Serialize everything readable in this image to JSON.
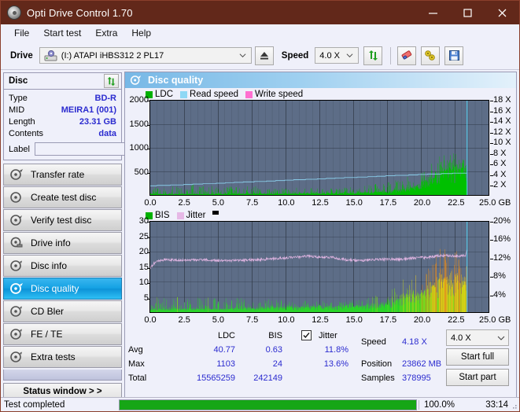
{
  "window": {
    "title": "Opti Drive Control 1.70",
    "icon": "disc-icon",
    "minimize": "minimize-icon",
    "maximize": "maximize-icon",
    "close": "close-icon"
  },
  "menu": {
    "items": [
      "File",
      "Start test",
      "Extra",
      "Help"
    ]
  },
  "toolbar": {
    "drive_label": "Drive",
    "drive_value": "(I:)  ATAPI iHBS312  2 PL17",
    "eject_icon": "eject-icon",
    "speed_label": "Speed",
    "speed_value": "4.0 X",
    "refresh_icon": "refresh-icon",
    "erase_icon": "eraser-icon",
    "tools_icon": "wrench-icon",
    "save_icon": "floppy-save-icon"
  },
  "disc": {
    "title": "Disc",
    "refresh_icon": "refresh-icon",
    "rows": [
      {
        "key": "Type",
        "value": "BD-R"
      },
      {
        "key": "MID",
        "value": "MEIRA1 (001)"
      },
      {
        "key": "Length",
        "value": "23.31 GB"
      },
      {
        "key": "Contents",
        "value": "data"
      }
    ],
    "label_key": "Label",
    "label_value": "",
    "label_placeholder": "",
    "label_btn_icon": "disc-icon"
  },
  "nav": {
    "items": [
      {
        "label": "Transfer rate",
        "icon": "disc-speed-icon",
        "selected": false
      },
      {
        "label": "Create test disc",
        "icon": "disc-write-icon",
        "selected": false
      },
      {
        "label": "Verify test disc",
        "icon": "disc-verify-icon",
        "selected": false
      },
      {
        "label": "Drive info",
        "icon": "drive-info-icon",
        "selected": false
      },
      {
        "label": "Disc info",
        "icon": "disc-info-icon",
        "selected": false
      },
      {
        "label": "Disc quality",
        "icon": "disc-quality-icon",
        "selected": true
      },
      {
        "label": "CD Bler",
        "icon": "cd-bler-icon",
        "selected": false
      },
      {
        "label": "FE / TE",
        "icon": "fe-te-icon",
        "selected": false
      },
      {
        "label": "Extra tests",
        "icon": "extra-tests-icon",
        "selected": false
      }
    ],
    "status_window": "Status window > >"
  },
  "panel": {
    "header": "Disc quality",
    "header_icon": "disc-quality-icon"
  },
  "stats": {
    "col_ldc": "LDC",
    "col_bis": "BIS",
    "jitter_label": "Jitter",
    "jitter_checked": true,
    "row_avg": "Avg",
    "row_max": "Max",
    "row_total": "Total",
    "avg_ldc": "40.77",
    "avg_bis": "0.63",
    "avg_jitter": "11.8%",
    "max_ldc": "1103",
    "max_bis": "24",
    "max_jitter": "13.6%",
    "total_ldc": "15565259",
    "total_bis": "242149",
    "speed_label": "Speed",
    "speed_value": "4.18 X",
    "position_label": "Position",
    "position_value": "23862 MB",
    "samples_label": "Samples",
    "samples_value": "378995",
    "speed_select": "4.0 X",
    "start_full": "Start full",
    "start_part": "Start part"
  },
  "statusbar": {
    "text": "Test completed",
    "percent": "100.0%",
    "progress": 100,
    "time": "33:14"
  },
  "colors": {
    "titlebar": "#62281a",
    "accent": "#15a2e4",
    "plot_bg": "#5d6d87",
    "ldc_green": "#00c000",
    "read_speed": "#8fd8f5",
    "write_speed": "#ff70d0",
    "jitter_pink": "#e6b8e6",
    "bis_green": "#2ad42a",
    "bis_yellow": "#e8d81e",
    "bis_orange": "#e08a20",
    "value_blue": "#2b2bcf",
    "progress_green": "#16a616"
  },
  "chart_data": [
    {
      "type": "area",
      "id": "ldc-chart",
      "title": "",
      "xlabel": "GB",
      "ylabel": "",
      "xlim": [
        0,
        25
      ],
      "ylim": [
        0,
        2000
      ],
      "y2lim": [
        0,
        18
      ],
      "y2label": "X",
      "xticks": [
        0.0,
        2.5,
        5.0,
        7.5,
        10.0,
        12.5,
        15.0,
        17.5,
        20.0,
        22.5,
        25.0
      ],
      "xticklabels": [
        "0.0",
        "2.5",
        "5.0",
        "7.5",
        "10.0",
        "12.5",
        "15.0",
        "17.5",
        "20.0",
        "22.5",
        "25.0 GB"
      ],
      "yticks": [
        500,
        1000,
        1500,
        2000
      ],
      "yticklabels": [
        "500",
        "1000",
        "1500",
        "2000"
      ],
      "y2ticks": [
        2,
        4,
        6,
        8,
        10,
        12,
        14,
        16,
        18
      ],
      "y2ticklabels": [
        "2 X",
        "4 X",
        "6 X",
        "8 X",
        "10 X",
        "12 X",
        "14 X",
        "16 X",
        "18 X"
      ],
      "grid": true,
      "legend": [
        {
          "label": "LDC",
          "color": "#00b000"
        },
        {
          "label": "Read speed",
          "color": "#8fd8f5"
        },
        {
          "label": "Write speed",
          "color": "#ff70d0"
        }
      ],
      "legend_position": "top-left",
      "data_end_gb": 23.4,
      "series": [
        {
          "name": "LDC",
          "type": "spikes",
          "color": "#00c000",
          "baseline_envelope": [
            {
              "x": 0.0,
              "base": 20,
              "peak": 170
            },
            {
              "x": 1.5,
              "base": 20,
              "peak": 200
            },
            {
              "x": 3.0,
              "base": 20,
              "peak": 230
            },
            {
              "x": 5.0,
              "base": 20,
              "peak": 180
            },
            {
              "x": 7.5,
              "base": 25,
              "peak": 200
            },
            {
              "x": 10.0,
              "base": 30,
              "peak": 160
            },
            {
              "x": 12.5,
              "base": 35,
              "peak": 150
            },
            {
              "x": 15.0,
              "base": 40,
              "peak": 170
            },
            {
              "x": 16.5,
              "base": 55,
              "peak": 230
            },
            {
              "x": 18.0,
              "base": 80,
              "peak": 330
            },
            {
              "x": 19.5,
              "base": 150,
              "peak": 430
            },
            {
              "x": 20.5,
              "base": 260,
              "peak": 560
            },
            {
              "x": 21.3,
              "base": 480,
              "peak": 880
            },
            {
              "x": 22.0,
              "base": 520,
              "peak": 900
            },
            {
              "x": 22.8,
              "base": 540,
              "peak": 890
            },
            {
              "x": 23.4,
              "base": 560,
              "peak": 900
            }
          ]
        },
        {
          "name": "Read speed",
          "type": "line",
          "color": "#8fd8f5",
          "points_x_speed": [
            [
              0.0,
              1.75
            ],
            [
              1.2,
              1.85
            ],
            [
              2.4,
              1.95
            ],
            [
              3.6,
              2.1
            ],
            [
              4.8,
              2.2
            ],
            [
              6.0,
              2.35
            ],
            [
              7.2,
              2.5
            ],
            [
              8.4,
              2.6
            ],
            [
              9.6,
              2.75
            ],
            [
              10.8,
              2.9
            ],
            [
              12.0,
              3.0
            ],
            [
              13.2,
              3.15
            ],
            [
              14.4,
              3.3
            ],
            [
              15.6,
              3.4
            ],
            [
              16.8,
              3.55
            ],
            [
              18.0,
              3.7
            ],
            [
              19.2,
              3.8
            ],
            [
              20.4,
              3.95
            ],
            [
              21.6,
              4.05
            ],
            [
              22.6,
              4.15
            ],
            [
              23.4,
              4.18
            ]
          ]
        }
      ],
      "cursor_line_gb": 23.4
    },
    {
      "type": "area",
      "id": "bis-chart",
      "title": "",
      "xlabel": "GB",
      "ylabel": "",
      "xlim": [
        0,
        25
      ],
      "ylim": [
        0,
        30
      ],
      "y2lim": [
        0,
        20
      ],
      "y2label": "%",
      "xticks": [
        0.0,
        2.5,
        5.0,
        7.5,
        10.0,
        12.5,
        15.0,
        17.5,
        20.0,
        22.5,
        25.0
      ],
      "xticklabels": [
        "0.0",
        "2.5",
        "5.0",
        "7.5",
        "10.0",
        "12.5",
        "15.0",
        "17.5",
        "20.0",
        "22.5",
        "25.0 GB"
      ],
      "yticks": [
        5,
        10,
        15,
        20,
        25,
        30
      ],
      "yticklabels": [
        "5",
        "10",
        "15",
        "20",
        "25",
        "30"
      ],
      "y2ticks": [
        4,
        8,
        12,
        16,
        20
      ],
      "y2ticklabels": [
        "4%",
        "8%",
        "12%",
        "16%",
        "20%"
      ],
      "grid": true,
      "legend": [
        {
          "label": "BIS",
          "color": "#00b000"
        },
        {
          "label": "Jitter",
          "color": "#e6b8e6"
        },
        {
          "label": "",
          "color": "#000000"
        }
      ],
      "legend_position": "top-left",
      "data_end_gb": 23.4,
      "series": [
        {
          "name": "BIS",
          "type": "spikes",
          "color": "#2ad42a",
          "baseline_envelope": [
            {
              "x": 0.0,
              "base": 1.0,
              "peak": 5.0
            },
            {
              "x": 2.0,
              "base": 1.0,
              "peak": 5.2
            },
            {
              "x": 4.0,
              "base": 1.0,
              "peak": 5.5
            },
            {
              "x": 6.0,
              "base": 1.0,
              "peak": 4.8
            },
            {
              "x": 8.0,
              "base": 1.2,
              "peak": 4.5
            },
            {
              "x": 10.0,
              "base": 1.5,
              "peak": 4.0
            },
            {
              "x": 12.5,
              "base": 1.6,
              "peak": 3.6
            },
            {
              "x": 15.0,
              "base": 1.8,
              "peak": 4.2
            },
            {
              "x": 16.5,
              "base": 2.2,
              "peak": 5.5
            },
            {
              "x": 18.0,
              "base": 3.2,
              "peak": 8.0
            },
            {
              "x": 19.0,
              "base": 5.5,
              "peak": 13.5
            },
            {
              "x": 20.0,
              "base": 6.0,
              "peak": 12.0
            },
            {
              "x": 21.0,
              "base": 9.0,
              "peak": 20.0
            },
            {
              "x": 21.4,
              "base": 11.0,
              "peak": 24.0
            },
            {
              "x": 22.0,
              "base": 10.0,
              "peak": 21.0
            },
            {
              "x": 22.6,
              "base": 9.5,
              "peak": 20.5
            },
            {
              "x": 23.4,
              "base": 9.0,
              "peak": 21.5
            }
          ]
        },
        {
          "name": "Jitter",
          "type": "line",
          "color": "#e6b8e6",
          "points_x_pct": [
            [
              0.0,
              9.8
            ],
            [
              0.4,
              11.2
            ],
            [
              1.0,
              11.6
            ],
            [
              2.0,
              11.5
            ],
            [
              3.0,
              11.5
            ],
            [
              4.0,
              11.6
            ],
            [
              5.0,
              11.4
            ],
            [
              6.0,
              11.4
            ],
            [
              7.0,
              11.5
            ],
            [
              8.0,
              11.6
            ],
            [
              9.0,
              11.8
            ],
            [
              10.0,
              12.0
            ],
            [
              11.0,
              12.2
            ],
            [
              11.5,
              12.4
            ],
            [
              12.5,
              12.2
            ],
            [
              13.5,
              12.1
            ],
            [
              14.5,
              11.6
            ],
            [
              15.5,
              11.4
            ],
            [
              16.5,
              11.6
            ],
            [
              17.5,
              11.7
            ],
            [
              18.5,
              11.7
            ],
            [
              19.5,
              12.0
            ],
            [
              20.5,
              12.1
            ],
            [
              21.3,
              12.5
            ],
            [
              22.0,
              12.5
            ],
            [
              22.8,
              12.4
            ],
            [
              23.3,
              12.6
            ],
            [
              23.4,
              13.6
            ]
          ]
        }
      ],
      "cursor_line_gb": 23.4
    }
  ]
}
